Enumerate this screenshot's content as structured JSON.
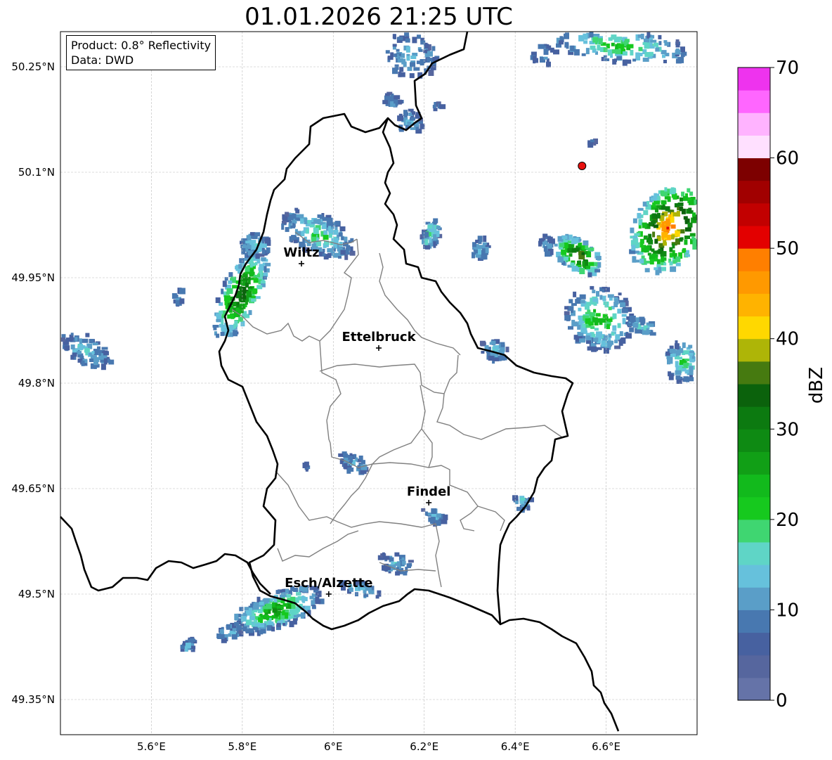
{
  "title": "01.01.2026 21:25 UTC",
  "info": {
    "product": "Product: 0.8° Reflectivity",
    "source": "Data: DWD"
  },
  "lat_ticks": [
    "50.25°N",
    "50.1°N",
    "49.95°N",
    "49.8°N",
    "49.65°N",
    "49.5°N",
    "49.35°N"
  ],
  "lon_ticks": [
    "5.6°E",
    "5.8°E",
    "6°E",
    "6.2°E",
    "6.4°E",
    "6.6°E"
  ],
  "extent": {
    "lon_min": 5.4,
    "lon_max": 6.8,
    "lat_min": 49.3,
    "lat_max": 50.3
  },
  "cities": [
    {
      "name": "Wiltz",
      "lon": 5.93,
      "lat": 49.97
    },
    {
      "name": "Ettelbruck",
      "lon": 6.1,
      "lat": 49.85
    },
    {
      "name": "Findel",
      "lon": 6.21,
      "lat": 49.63
    },
    {
      "name": "Esch/Alzette",
      "lon": 5.99,
      "lat": 49.5
    }
  ],
  "radar_site": {
    "lon": 6.547,
    "lat": 50.109,
    "color": "#e8110f"
  },
  "colorbar": {
    "label": "dBZ",
    "min": 0,
    "max": 70,
    "ticks": [
      "0",
      "10",
      "20",
      "30",
      "40",
      "50",
      "60",
      "70"
    ],
    "colors": [
      "#6573a8",
      "#56669e",
      "#4761a0",
      "#4878b0",
      "#5a9ec8",
      "#66c1dc",
      "#5fd5c6",
      "#3fd671",
      "#16c91e",
      "#12ba1c",
      "#119f16",
      "#0e8a13",
      "#0c7a10",
      "#0b620c",
      "#467a10",
      "#aeb507",
      "#ffd800",
      "#ffb300",
      "#ff9900",
      "#ff7f00",
      "#e30000",
      "#c20000",
      "#a10000",
      "#7d0000",
      "#ffe0ff",
      "#ffb3ff",
      "#ff66ff",
      "#ee33ee"
    ]
  },
  "colors": {
    "country_border": "#000000",
    "canton_border": "#808080",
    "grid": "#bbbbbb"
  }
}
